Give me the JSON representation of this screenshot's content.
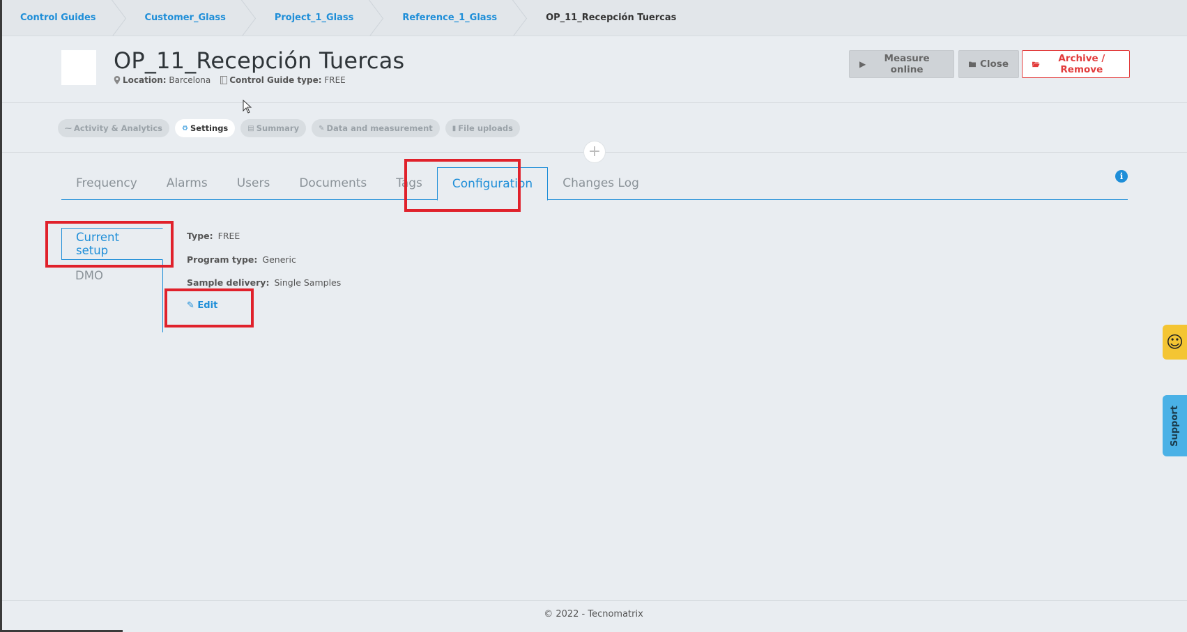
{
  "breadcrumb": {
    "items": [
      "Control Guides",
      "Customer_Glass",
      "Project_1_Glass",
      "Reference_1_Glass"
    ],
    "current": "OP_11_Recepción Tuercas"
  },
  "header": {
    "title": "OP_11_Recepción Tuercas",
    "location_label": "Location:",
    "location_value": "Barcelona",
    "type_label": "Control Guide type:",
    "type_value": "FREE",
    "measure_label": "Measure online",
    "close_label": "Close",
    "archive_label": "Archive / Remove"
  },
  "pills": [
    "Activity & Analytics",
    "Settings",
    "Summary",
    "Data and measurement",
    "File uploads"
  ],
  "tabs": [
    "Frequency",
    "Alarms",
    "Users",
    "Documents",
    "Tags",
    "Configuration",
    "Changes Log"
  ],
  "side_nav": {
    "current": "Current setup",
    "dmo": "DMO"
  },
  "config": {
    "type_label": "Type:",
    "type_value": "FREE",
    "program_label": "Program type:",
    "program_value": "Generic",
    "sample_label": "Sample delivery:",
    "sample_value": "Single Samples",
    "edit_label": "Edit"
  },
  "footer": "© 2022 - Tecnomatrix",
  "widgets": {
    "support_label": "Support"
  },
  "colors": {
    "accent": "#1e8ed8",
    "danger": "#e23b3b",
    "highlight": "#e0212b",
    "background": "#e9edf1"
  }
}
